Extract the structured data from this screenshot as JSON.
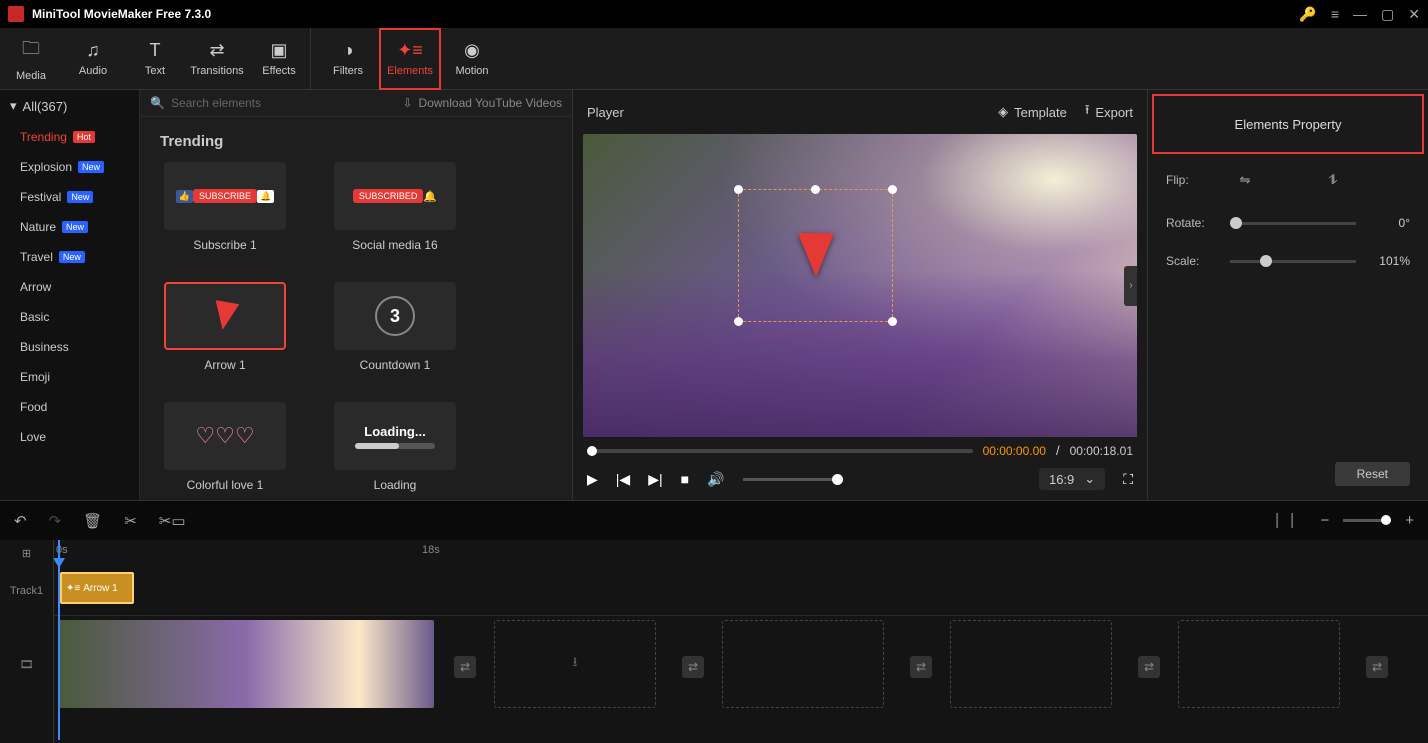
{
  "app": {
    "title": "MiniTool MovieMaker Free 7.3.0"
  },
  "toolbar": {
    "media": "Media",
    "audio": "Audio",
    "text": "Text",
    "transitions": "Transitions",
    "effects": "Effects",
    "filters": "Filters",
    "elements": "Elements",
    "motion": "Motion"
  },
  "sidebar": {
    "all": "All(367)",
    "cats": [
      {
        "label": "Trending",
        "badge": "Hot",
        "badgeClass": "hot",
        "active": true
      },
      {
        "label": "Explosion",
        "badge": "New",
        "badgeClass": "new"
      },
      {
        "label": "Festival",
        "badge": "New",
        "badgeClass": "new"
      },
      {
        "label": "Nature",
        "badge": "New",
        "badgeClass": "new"
      },
      {
        "label": "Travel",
        "badge": "New",
        "badgeClass": "new"
      },
      {
        "label": "Arrow"
      },
      {
        "label": "Basic"
      },
      {
        "label": "Business"
      },
      {
        "label": "Emoji"
      },
      {
        "label": "Food"
      },
      {
        "label": "Love"
      }
    ]
  },
  "browser": {
    "search_placeholder": "Search elements",
    "download": "Download YouTube Videos",
    "section": "Trending",
    "items": [
      {
        "label": "Subscribe 1",
        "kind": "subscribe"
      },
      {
        "label": "Social media 16",
        "kind": "subscribed"
      },
      {
        "label": "Arrow 1",
        "kind": "arrow",
        "selected": true
      },
      {
        "label": "Countdown 1",
        "kind": "countdown"
      },
      {
        "label": "Colorful love 1",
        "kind": "love"
      },
      {
        "label": "Loading",
        "kind": "loading"
      }
    ]
  },
  "player": {
    "title": "Player",
    "template": "Template",
    "export": "Export",
    "time_current": "00:00:00.00",
    "time_sep": " / ",
    "time_total": "00:00:18.01",
    "aspect": "16:9"
  },
  "props": {
    "title": "Elements Property",
    "flip": "Flip:",
    "rotate": "Rotate:",
    "rotate_val": "0°",
    "scale": "Scale:",
    "scale_val": "101%",
    "reset": "Reset"
  },
  "timeline": {
    "mark0": "0s",
    "mark18": "18s",
    "track1": "Track1",
    "clip": "Arrow 1",
    "countdown_preview": "3",
    "loading_preview": "Loading..."
  }
}
